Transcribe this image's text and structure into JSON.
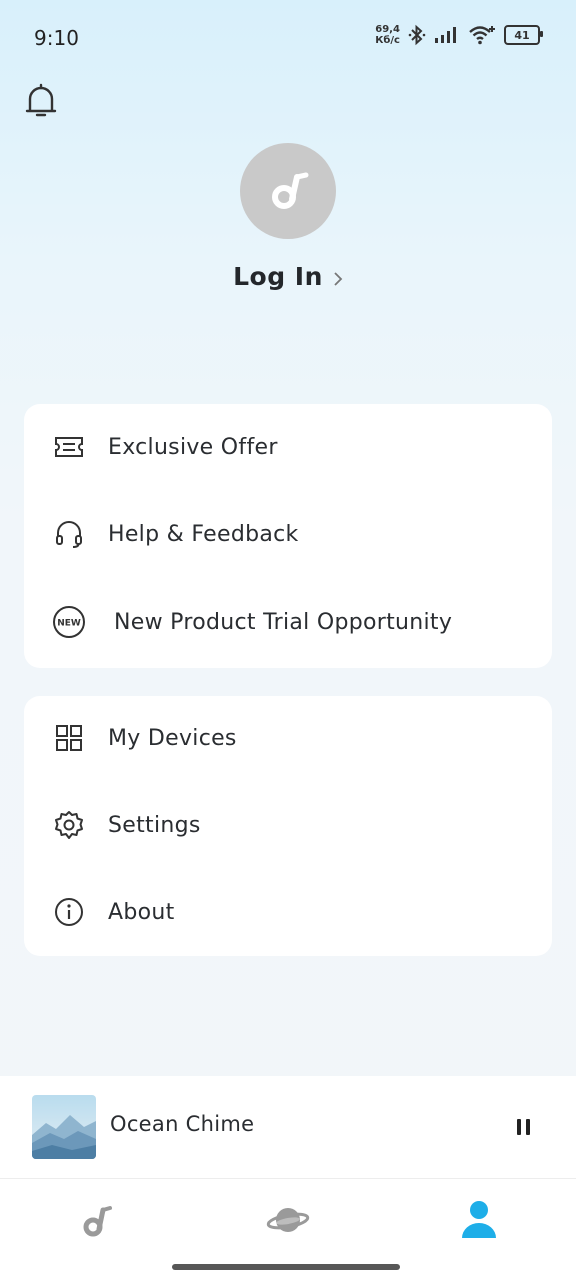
{
  "status": {
    "time": "9:10",
    "net_speed_value": "69,4",
    "net_speed_unit": "Кб/с",
    "battery": "41"
  },
  "header": {
    "login_label": "Log In"
  },
  "menu_group_1": [
    {
      "label": "Exclusive Offer",
      "icon": "ticket-icon"
    },
    {
      "label": "Help & Feedback",
      "icon": "headset-icon"
    },
    {
      "label": "New Product Trial Opportunity",
      "icon": "new-badge-icon",
      "badge": "NEW"
    }
  ],
  "menu_group_2": [
    {
      "label": "My Devices",
      "icon": "grid-icon"
    },
    {
      "label": "Settings",
      "icon": "gear-icon"
    },
    {
      "label": "About",
      "icon": "info-icon"
    }
  ],
  "player": {
    "track_title": "Ocean Chime",
    "state": "playing"
  },
  "tabs": [
    {
      "name": "home",
      "icon": "music-note-icon",
      "active": false
    },
    {
      "name": "explore",
      "icon": "planet-icon",
      "active": false
    },
    {
      "name": "profile",
      "icon": "profile-icon",
      "active": true
    }
  ],
  "colors": {
    "accent": "#1eaee8",
    "avatar_bg": "#c9c9c9",
    "inactive_icon": "#9a9a9a"
  }
}
